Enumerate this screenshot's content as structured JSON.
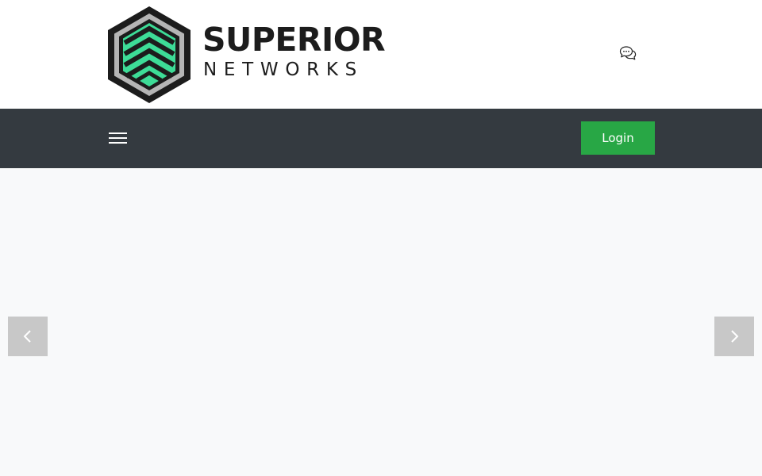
{
  "brand": {
    "name_line1": "SUPERIOR",
    "name_line2": "NETWORKS",
    "logo_icon": "hexagon-chevron-logo",
    "colors": {
      "mark_dark": "#1c1c1c",
      "mark_green": "#3ddc97",
      "mark_silver": "#b5b5b5"
    }
  },
  "header": {
    "chat_icon": "chat-bubbles-icon"
  },
  "navbar": {
    "menu_icon": "hamburger-menu-icon",
    "login_label": "Login",
    "colors": {
      "background": "#343a40",
      "login": "#28a745"
    }
  },
  "carousel": {
    "prev_icon": "chevron-left-icon",
    "next_icon": "chevron-right-icon",
    "colors": {
      "background": "#f8f9fa",
      "arrow": "#c8c8c8"
    }
  }
}
